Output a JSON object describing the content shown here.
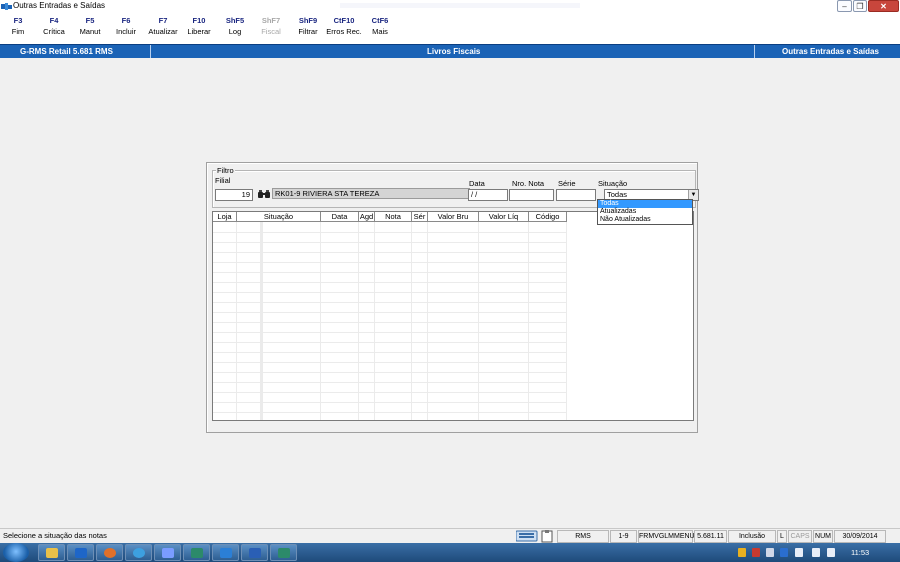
{
  "window": {
    "title": "Outras Entradas e Saídas"
  },
  "toolbar": {
    "items": [
      {
        "key": "F3",
        "label": "Fim",
        "enabled": true
      },
      {
        "key": "F4",
        "label": "Crítica",
        "enabled": true
      },
      {
        "key": "F5",
        "label": "Manut",
        "enabled": true
      },
      {
        "key": "F6",
        "label": "Incluir",
        "enabled": true
      },
      {
        "key": "F7",
        "label": "Atualizar",
        "enabled": true
      },
      {
        "key": "F10",
        "label": "Liberar",
        "enabled": true
      },
      {
        "key": "ShF5",
        "label": "Log",
        "enabled": true
      },
      {
        "key": "ShF7",
        "label": "Fiscal",
        "enabled": false
      },
      {
        "key": "ShF9",
        "label": "Filtrar",
        "enabled": true
      },
      {
        "key": "CtF10",
        "label": "Erros Rec.",
        "enabled": true
      },
      {
        "key": "CtF6",
        "label": "Mais",
        "enabled": true
      }
    ]
  },
  "header": {
    "app": "G-RMS Retail 5.681 RMS",
    "module": "Livros Fiscais",
    "screen": "Outras Entradas e Saídas",
    "color": "#1b63b6"
  },
  "filter": {
    "legend": "Filtro",
    "filial_label": "Filial",
    "filial_value": "19",
    "filial_name": "RK01-9 RIVIERA STA TEREZA",
    "data_label": "Data",
    "data_value": "/ /",
    "nro_nota_label": "Nro. Nota",
    "nro_nota_value": "",
    "serie_label": "Série",
    "serie_value": "",
    "situacao_label": "Situação",
    "situacao_value": "Todas",
    "situacao_options": [
      "Todas",
      "Atualizadas",
      "Não Atualizadas"
    ],
    "situacao_selected_index": 0
  },
  "grid": {
    "columns": [
      "Loja",
      "Situação",
      "Data",
      "Agd",
      "Nota",
      "Sér",
      "Valor Bru",
      "Valor Líq",
      "Código"
    ],
    "rows": []
  },
  "statusbar": {
    "message": "Selecione a situação das notas",
    "user": "RMS",
    "filial": "1-9",
    "form": "FRMVGLMMENU",
    "version": "5.681.11",
    "mode": "Inclusão",
    "l": "L",
    "caps": "CAPS",
    "num": "NUM",
    "date": "30/09/2014"
  },
  "taskbar": {
    "clock": "11:53"
  }
}
